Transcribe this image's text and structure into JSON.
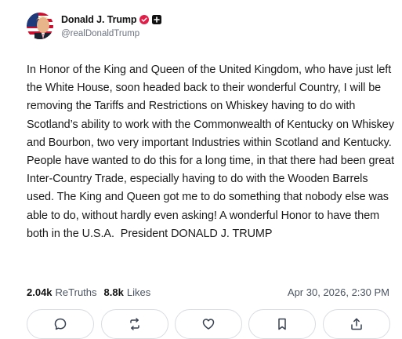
{
  "author": {
    "name": "Donald J. Trump",
    "handle": "@realDonaldTrump",
    "avatar_icon": "avatar-flag-portrait",
    "verified_color": "#e11d48"
  },
  "post": {
    "text": "In Honor of the King and Queen of the United Kingdom, who have just left the White House, soon headed back to their wonderful Country, I will be removing the Tariffs and Restrictions on Whiskey having to do with Scotland’s ability to work with the Commonwealth of Kentucky on Whiskey and Bourbon, two very important Industries within Scotland and Kentucky. People have wanted to do this for a long time, in that there had been great Inter-Country Trade, especially having to do with the Wooden Barrels used. The King and Queen got me to do something that nobody else was able to do, without hardly even asking! A wonderful Honor to have them both in the U.S.A.  President DONALD J. TRUMP"
  },
  "stats": {
    "retruths_count": "2.04k",
    "retruths_label": "ReTruths",
    "likes_count": "8.8k",
    "likes_label": "Likes",
    "timestamp": "Apr 30, 2026, 2:30 PM"
  },
  "actions": [
    {
      "name": "reply",
      "icon": "comment-icon"
    },
    {
      "name": "retruth",
      "icon": "retruth-icon"
    },
    {
      "name": "like",
      "icon": "heart-icon"
    },
    {
      "name": "bookmark",
      "icon": "bookmark-icon"
    },
    {
      "name": "share",
      "icon": "share-icon"
    }
  ]
}
